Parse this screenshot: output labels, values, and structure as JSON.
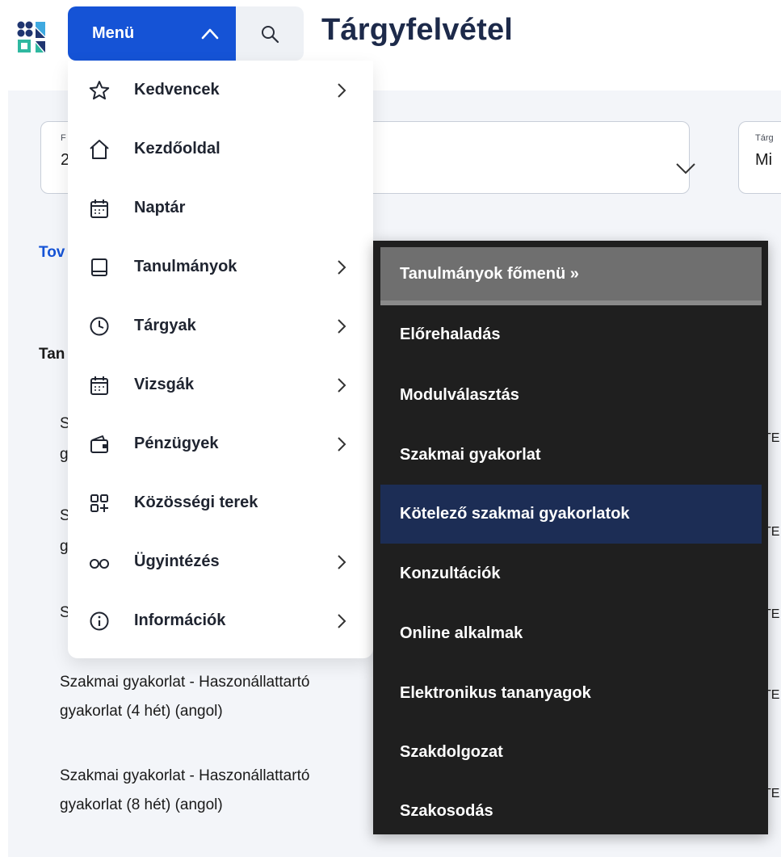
{
  "header": {
    "menu_label": "Menü",
    "page_title": "Tárgyfelvétel"
  },
  "background": {
    "field1": {
      "label_fragment": "F",
      "value_fragment": "2"
    },
    "field2": {
      "label_fragment": "Tárg",
      "value_fragment": "Mi"
    },
    "link_fragment": "Tov",
    "section_fragment": "Tan",
    "rows": [
      {
        "line1": "S",
        "line2": "g",
        "right": "TE"
      },
      {
        "line1": "S",
        "line2": "g",
        "right": "TE"
      },
      {
        "line1": "S",
        "line2": "",
        "right": "TE"
      },
      {
        "line1": "Szakmai gyakorlat - Haszonállattartó",
        "line2": "gyakorlat (4 hét) (angol)",
        "right": "TE"
      },
      {
        "line1": "Szakmai gyakorlat - Haszonállattartó",
        "line2": "gyakorlat (8 hét) (angol)",
        "right": "TE"
      }
    ]
  },
  "menu": {
    "items": [
      {
        "label": "Kedvencek",
        "icon": "star-icon",
        "has_submenu": true
      },
      {
        "label": "Kezdőoldal",
        "icon": "home-icon",
        "has_submenu": false
      },
      {
        "label": "Naptár",
        "icon": "calendar-icon",
        "has_submenu": false
      },
      {
        "label": "Tanulmányok",
        "icon": "book-icon",
        "has_submenu": true
      },
      {
        "label": "Tárgyak",
        "icon": "clock-icon",
        "has_submenu": true
      },
      {
        "label": "Vizsgák",
        "icon": "calendar-icon",
        "has_submenu": true
      },
      {
        "label": "Pénzügyek",
        "icon": "wallet-icon",
        "has_submenu": true
      },
      {
        "label": "Közösségi terek",
        "icon": "grid-plus-icon",
        "has_submenu": false
      },
      {
        "label": "Ügyintézés",
        "icon": "glasses-icon",
        "has_submenu": true
      },
      {
        "label": "Információk",
        "icon": "info-icon",
        "has_submenu": true
      }
    ]
  },
  "submenu": {
    "header": "Tanulmányok főmenü »",
    "items": [
      {
        "label": "Előrehaladás"
      },
      {
        "label": "Modulválasztás"
      },
      {
        "label": "Szakmai gyakorlat"
      },
      {
        "label": "Kötelező szakmai gyakorlatok",
        "active": true
      },
      {
        "label": "Konzultációk"
      },
      {
        "label": "Online alkalmak"
      },
      {
        "label": "Elektronikus tananyagok"
      },
      {
        "label": "Szakdolgozat"
      },
      {
        "label": "Szakosodás"
      }
    ]
  },
  "colors": {
    "primary": "#1553d6",
    "title": "#1d2a4a",
    "submenu_bg": "#1f1f1f",
    "submenu_active": "#1c2d55",
    "submenu_header": "#6f6f6f"
  }
}
